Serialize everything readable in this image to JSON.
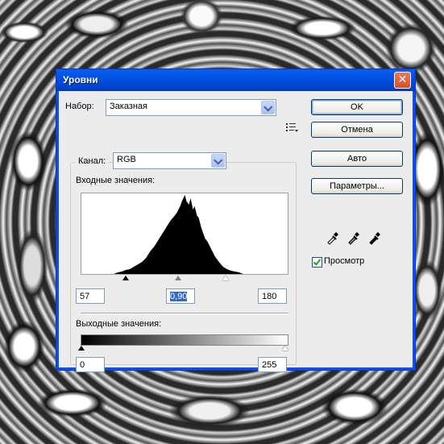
{
  "dialog": {
    "title": "Уровни",
    "close_glyph": "✕"
  },
  "preset": {
    "label": "Набор:",
    "value": "Заказная"
  },
  "channel": {
    "label": "Канал:",
    "value": "RGB"
  },
  "input_levels": {
    "label": "Входные значения:",
    "black": "57",
    "gamma": "0,90",
    "white": "180"
  },
  "output_levels": {
    "label": "Выходные значения:",
    "black": "0",
    "white": "255"
  },
  "buttons": {
    "ok": "OK",
    "cancel": "Отмена",
    "auto": "Авто",
    "options": "Параметры..."
  },
  "preview": {
    "label": "Просмотр",
    "checked": true
  },
  "icons": {
    "preset_menu": "list-menu-icon",
    "eyedroppers": [
      "black-eyedropper-icon",
      "gray-eyedropper-icon",
      "white-eyedropper-icon"
    ]
  },
  "colors": {
    "titlebar": "#0a5ff0",
    "close_button": "#d4502a",
    "selection": "#316ac5"
  },
  "chart_data": {
    "type": "area",
    "xlim": [
      0,
      255
    ],
    "x": [
      40,
      45,
      50,
      55,
      60,
      65,
      70,
      75,
      80,
      85,
      90,
      95,
      100,
      105,
      110,
      115,
      118,
      120,
      122,
      125,
      128,
      130,
      133,
      135,
      138,
      140,
      143,
      145,
      148,
      150,
      153,
      156,
      160,
      165,
      170,
      175,
      180,
      185,
      190,
      195,
      200
    ],
    "values": [
      0,
      2,
      3,
      5,
      6,
      9,
      12,
      15,
      20,
      28,
      34,
      42,
      50,
      58,
      66,
      72,
      76,
      80,
      84,
      92,
      98,
      90,
      86,
      94,
      80,
      84,
      72,
      70,
      58,
      52,
      44,
      40,
      32,
      22,
      15,
      9,
      6,
      4,
      3,
      2,
      0
    ],
    "ylim": [
      0,
      100
    ]
  }
}
